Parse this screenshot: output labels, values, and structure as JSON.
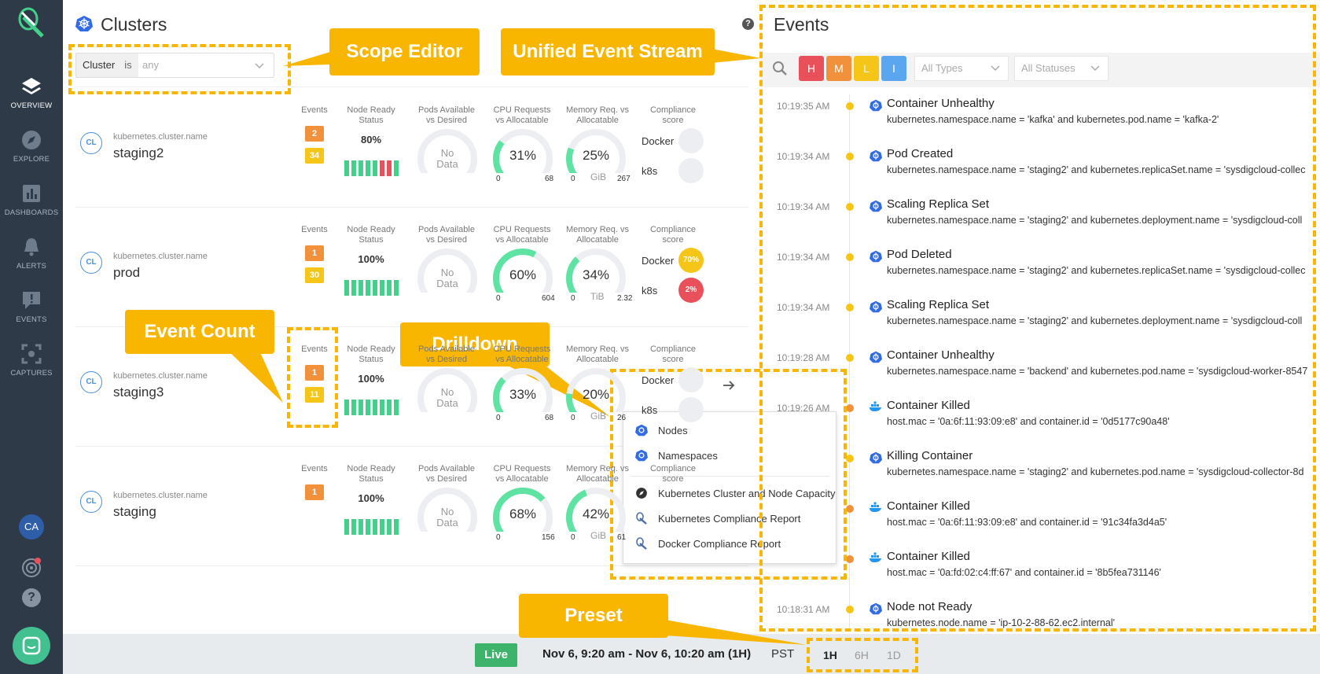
{
  "sidebar": {
    "items": [
      {
        "label": "OVERVIEW",
        "icon": "layers-icon"
      },
      {
        "label": "EXPLORE",
        "icon": "compass-icon"
      },
      {
        "label": "DASHBOARDS",
        "icon": "bar-chart-icon"
      },
      {
        "label": "ALERTS",
        "icon": "bell-icon"
      },
      {
        "label": "EVENTS",
        "icon": "event-icon"
      },
      {
        "label": "CAPTURES",
        "icon": "capture-icon"
      }
    ],
    "user_initials": "CA"
  },
  "clusters": {
    "title": "Clusters",
    "scope": {
      "key": "Cluster",
      "op": "is",
      "value": "any"
    },
    "headers": {
      "events": "Events",
      "node_ready": "Node Ready\nStatus",
      "pods": "Pods Available\nvs Desired",
      "cpu": "CPU Requests\nvs Allocatable",
      "memory": "Memory Req. vs\nAllocatable",
      "compliance": "Compliance\nscore"
    },
    "rows": [
      {
        "label": "kubernetes.cluster.name",
        "name": "staging2",
        "events_m": "2",
        "events_l": "34",
        "node_ready": "80%",
        "pods": "No\nData",
        "cpu": "31%",
        "cpu_min": "0",
        "cpu_max": "68",
        "mem": "25%",
        "mem_unit": "GiB",
        "mem_min": "0",
        "mem_max": "267",
        "docker": "Docker",
        "docker_score": "",
        "k8s": "k8s",
        "k8s_score": ""
      },
      {
        "label": "kubernetes.cluster.name",
        "name": "prod",
        "events_m": "1",
        "events_l": "30",
        "node_ready": "100%",
        "pods": "No\nData",
        "cpu": "60%",
        "cpu_min": "0",
        "cpu_max": "604",
        "mem": "34%",
        "mem_unit": "TiB",
        "mem_min": "0",
        "mem_max": "2.32",
        "docker": "Docker",
        "docker_score": "70%",
        "k8s": "k8s",
        "k8s_score": "2%"
      },
      {
        "label": "kubernetes.cluster.name",
        "name": "staging3",
        "events_m": "1",
        "events_l": "11",
        "node_ready": "100%",
        "pods": "No\nData",
        "cpu": "33%",
        "cpu_min": "0",
        "cpu_max": "68",
        "mem": "20%",
        "mem_unit": "GiB",
        "mem_min": "0",
        "mem_max": "26",
        "docker": "Docker",
        "docker_score": "",
        "k8s": "k8s",
        "k8s_score": ""
      },
      {
        "label": "kubernetes.cluster.name",
        "name": "staging",
        "events_m": "1",
        "events_l": "",
        "node_ready": "100%",
        "pods": "No\nData",
        "cpu": "68%",
        "cpu_min": "0",
        "cpu_max": "156",
        "mem": "42%",
        "mem_unit": "GiB",
        "mem_min": "0",
        "mem_max": "61",
        "docker": "",
        "docker_score": "",
        "k8s": "",
        "k8s_score": ""
      }
    ]
  },
  "drilldown": {
    "items": [
      "Nodes",
      "Namespaces",
      "Kubernetes Cluster and Node Capacity",
      "Kubernetes Compliance Report",
      "Docker Compliance Report"
    ]
  },
  "events": {
    "title": "Events",
    "severity": [
      "H",
      "M",
      "L",
      "I"
    ],
    "types_placeholder": "All Types",
    "statuses_placeholder": "All Statuses",
    "items": [
      {
        "time": "10:19:35 AM",
        "name": "Container Unhealthy",
        "desc": "kubernetes.namespace.name = 'kafka' and kubernetes.pod.name = 'kafka-2'",
        "sev": "low",
        "icon": "kubernetes-icon"
      },
      {
        "time": "10:19:34 AM",
        "name": "Pod Created",
        "desc": "kubernetes.namespace.name = 'staging2' and kubernetes.replicaSet.name = 'sysdigcloud-collec",
        "sev": "low",
        "icon": "kubernetes-icon"
      },
      {
        "time": "10:19:34 AM",
        "name": "Scaling Replica Set",
        "desc": "kubernetes.namespace.name = 'staging2' and kubernetes.deployment.name = 'sysdigcloud-coll",
        "sev": "low",
        "icon": "kubernetes-icon"
      },
      {
        "time": "10:19:34 AM",
        "name": "Pod Deleted",
        "desc": "kubernetes.namespace.name = 'staging2' and kubernetes.replicaSet.name = 'sysdigcloud-collec",
        "sev": "low",
        "icon": "kubernetes-icon"
      },
      {
        "time": "10:19:34 AM",
        "name": "Scaling Replica Set",
        "desc": "kubernetes.namespace.name = 'staging2' and kubernetes.deployment.name = 'sysdigcloud-coll",
        "sev": "low",
        "icon": "kubernetes-icon"
      },
      {
        "time": "10:19:28 AM",
        "name": "Container Unhealthy",
        "desc": "kubernetes.namespace.name = 'backend' and kubernetes.pod.name = 'sysdigcloud-worker-8547",
        "sev": "low",
        "icon": "kubernetes-icon"
      },
      {
        "time": "10:19:26 AM",
        "name": "Container Killed",
        "desc": "host.mac = '0a:6f:11:93:09:e8' and container.id = '0d5177c90a48'",
        "sev": "medium",
        "icon": "docker-icon"
      },
      {
        "time": "",
        "name": "Killing Container",
        "desc": "kubernetes.namespace.name = 'staging2' and kubernetes.pod.name = 'sysdigcloud-collector-8d",
        "sev": "low",
        "icon": "kubernetes-icon"
      },
      {
        "time": "",
        "name": "Container Killed",
        "desc": "host.mac = '0a:6f:11:93:09:e8' and container.id = '91c34fa3d4a5'",
        "sev": "medium",
        "icon": "docker-icon"
      },
      {
        "time": "",
        "name": "Container Killed",
        "desc": "host.mac = '0a:fd:02:c4:ff:67' and container.id = '8b5fea731146'",
        "sev": "medium",
        "icon": "docker-icon"
      },
      {
        "time": "10:18:31 AM",
        "name": "Node not Ready",
        "desc": "kubernetes.node.name = 'ip-10-2-88-62.ec2.internal'",
        "sev": "low",
        "icon": "kubernetes-icon"
      }
    ]
  },
  "footer": {
    "live": "Live",
    "range": "Nov 6, 9:20 am - Nov 6, 10:20 am (1H)",
    "tz": "PST",
    "presets": [
      "1H",
      "6H",
      "1D"
    ]
  },
  "callouts": {
    "scope_editor": "Scope Editor",
    "unified_stream": "Unified Event Stream",
    "event_count": "Event Count",
    "drilldown": "Drilldown",
    "preset": "Preset"
  },
  "colors": {
    "high": "#e8515a",
    "medium": "#f1913b",
    "low": "#f5c518",
    "info": "#5aa7f0",
    "accent": "#f8b600",
    "ok": "#43d08a"
  }
}
